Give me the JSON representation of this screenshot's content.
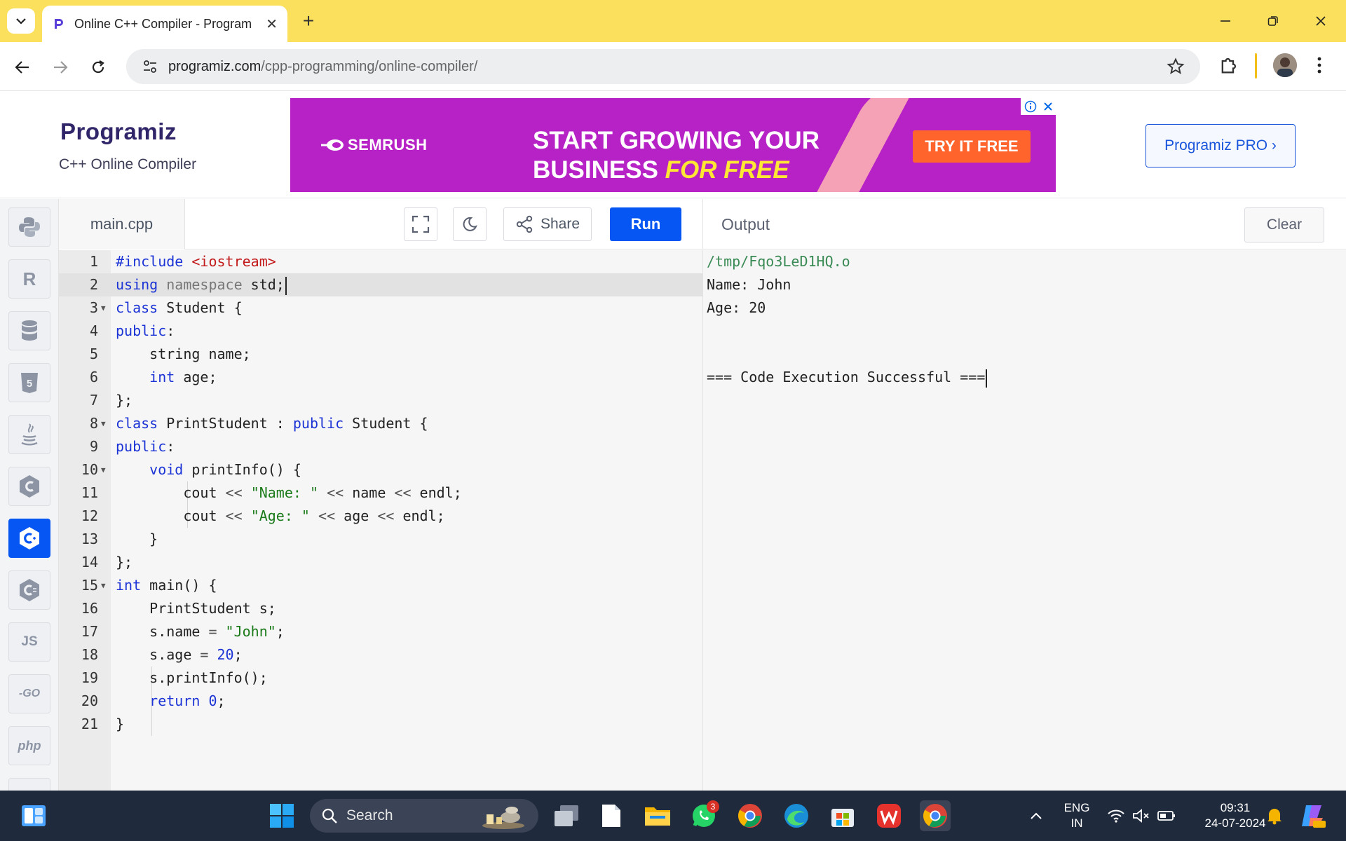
{
  "browser": {
    "tab_title": "Online C++ Compiler - Program",
    "url_host": "programiz.com",
    "url_path": "/cpp-programming/online-compiler/"
  },
  "site": {
    "logo_text": "rogramiz",
    "logo_initial": "P",
    "subtitle": "C++ Online Compiler",
    "pro_button": "Programiz PRO ›"
  },
  "ad": {
    "brand": "SEMRUSH",
    "headline_line1": "START GROWING YOUR",
    "headline_line2": "BUSINESS",
    "headline_accent": "FOR FREE",
    "cta": "TRY IT FREE"
  },
  "languages": [
    {
      "name": "python-icon",
      "label": ""
    },
    {
      "name": "r-icon",
      "label": "R"
    },
    {
      "name": "sql-icon",
      "label": ""
    },
    {
      "name": "html5-icon",
      "label": "5"
    },
    {
      "name": "java-icon",
      "label": ""
    },
    {
      "name": "c-icon",
      "label": "C"
    },
    {
      "name": "cpp-icon",
      "label": "C"
    },
    {
      "name": "csharp-icon",
      "label": "C"
    },
    {
      "name": "js-icon",
      "label": "JS"
    },
    {
      "name": "go-icon",
      "label": "-GO"
    },
    {
      "name": "php-icon",
      "label": "php"
    }
  ],
  "editor": {
    "file_name": "main.cpp",
    "share_label": "Share",
    "run_label": "Run",
    "lines": [
      {
        "n": "1",
        "html": "<span class='kw'>#include</span> <span class='inc'>&lt;iostream&gt;</span>"
      },
      {
        "n": "2",
        "html": "<span class='kw'>using</span> <span class='ns'>namespace</span> std;",
        "current": true
      },
      {
        "n": "3",
        "html": "<span class='kw'>class</span> Student {",
        "fold": true
      },
      {
        "n": "4",
        "html": "<span class='kw'>public</span>:"
      },
      {
        "n": "5",
        "html": "    string name;"
      },
      {
        "n": "6",
        "html": "    <span class='kw'>int</span> age;"
      },
      {
        "n": "7",
        "html": "};"
      },
      {
        "n": "8",
        "html": "<span class='kw'>class</span> PrintStudent : <span class='kw'>public</span> Student {",
        "fold": true
      },
      {
        "n": "9",
        "html": "<span class='kw'>public</span>:"
      },
      {
        "n": "10",
        "html": "    <span class='kw'>void</span> printInfo() {",
        "fold": true
      },
      {
        "n": "11",
        "html": "        cout <span class='op'>&lt;&lt;</span> <span class='str'>\"Name: \"</span> <span class='op'>&lt;&lt;</span> name <span class='op'>&lt;&lt;</span> endl;"
      },
      {
        "n": "12",
        "html": "        cout <span class='op'>&lt;&lt;</span> <span class='str'>\"Age: \"</span> <span class='op'>&lt;&lt;</span> age <span class='op'>&lt;&lt;</span> endl;"
      },
      {
        "n": "13",
        "html": "    }"
      },
      {
        "n": "14",
        "html": "};"
      },
      {
        "n": "15",
        "html": "<span class='kw'>int</span> main() {",
        "fold": true
      },
      {
        "n": "16",
        "html": "    PrintStudent s;"
      },
      {
        "n": "17",
        "html": "    s.name <span class='op'>=</span> <span class='str'>\"John\"</span>;"
      },
      {
        "n": "18",
        "html": "    s.age <span class='op'>=</span> <span class='num'>20</span>;"
      },
      {
        "n": "19",
        "html": "    s.printInfo();"
      },
      {
        "n": "20",
        "html": "    <span class='kw'>return</span> <span class='num'>0</span>;"
      },
      {
        "n": "21",
        "html": "}"
      }
    ]
  },
  "output": {
    "title": "Output",
    "clear_label": "Clear",
    "lines": [
      "/tmp/Fqo3LeD1HQ.o",
      "Name: John",
      "Age: 20",
      "",
      "",
      "=== Code Execution Successful ==="
    ]
  },
  "taskbar": {
    "search_placeholder": "Search",
    "whatsapp_badge": "3",
    "lang_line1": "ENG",
    "lang_line2": "IN",
    "time": "09:31",
    "date": "24-07-2024"
  },
  "colors": {
    "tabbar": "#fbe05d",
    "run_button": "#0556f3",
    "ad_background": "#b622c5",
    "ad_cta": "#ff642d",
    "keyword": "#1c34d6",
    "string": "#1a7a1a"
  }
}
